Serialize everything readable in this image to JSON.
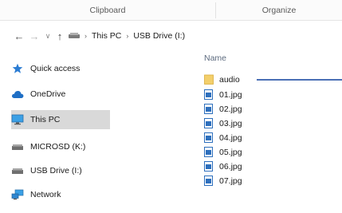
{
  "ribbon": {
    "groups": [
      {
        "label": "Clipboard"
      },
      {
        "label": "Organize"
      }
    ]
  },
  "address": {
    "crumbs": [
      "This PC",
      "USB Drive (I:)"
    ]
  },
  "navigation": {
    "items": [
      {
        "label": "Quick access",
        "icon": "star-icon"
      },
      {
        "label": "OneDrive",
        "icon": "cloud-icon"
      },
      {
        "label": "This PC",
        "icon": "monitor-icon",
        "selected": true
      },
      {
        "label": "MICROSD (K:)",
        "icon": "drive-icon"
      },
      {
        "label": "USB Drive (I:)",
        "icon": "drive-icon"
      },
      {
        "label": "Network",
        "icon": "network-icon"
      }
    ]
  },
  "content": {
    "column_header": "Name",
    "files": [
      {
        "name": "audio",
        "type": "folder"
      },
      {
        "name": "01.jpg",
        "type": "image"
      },
      {
        "name": "02.jpg",
        "type": "image"
      },
      {
        "name": "03.jpg",
        "type": "image"
      },
      {
        "name": "04.jpg",
        "type": "image"
      },
      {
        "name": "05.jpg",
        "type": "image"
      },
      {
        "name": "06.jpg",
        "type": "image"
      },
      {
        "name": "07.jpg",
        "type": "image"
      }
    ]
  },
  "colors": {
    "folder": "#f3cf6b",
    "image_icon": "#2d6fbd",
    "selection": "#d9d9d9",
    "pointer_line": "#4a6fb5"
  }
}
